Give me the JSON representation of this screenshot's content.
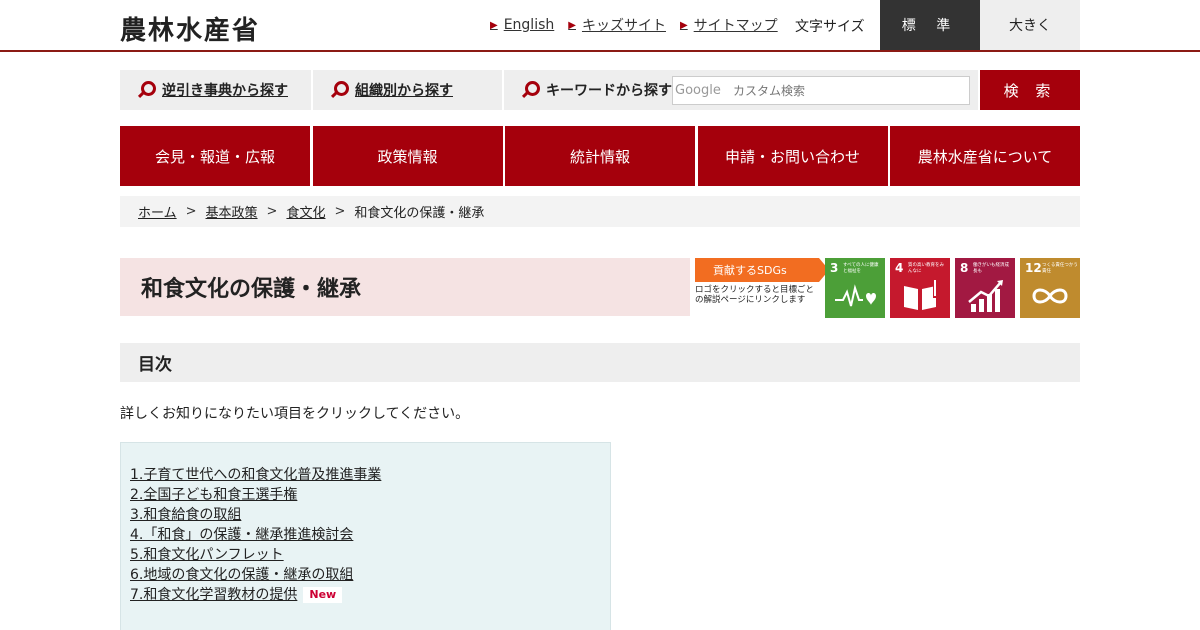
{
  "header": {
    "logo": "農林水産省",
    "links": [
      "English",
      "キッズサイト",
      "サイトマップ"
    ],
    "font_size_label": "文字サイズ",
    "font_size_standard": "標 準",
    "font_size_large": "大きく"
  },
  "search": {
    "reverse_lookup": "逆引き事典から探す",
    "by_org": "組織別から探す",
    "keyword_label": "キーワードから探す",
    "google_mark": "Google",
    "placeholder": "カスタム検索",
    "button": "検 索"
  },
  "nav": {
    "items": [
      "会見・報道・広報",
      "政策情報",
      "統計情報",
      "申請・お問い合わせ",
      "農林水産省について"
    ]
  },
  "breadcrumb": {
    "home": "ホーム",
    "basic_policy": "基本政策",
    "food_culture": "食文化",
    "current": "和食文化の保護・継承",
    "separator": ">"
  },
  "page": {
    "title": "和食文化の保護・継承"
  },
  "sdgs": {
    "badge": "貢献するSDGs",
    "note": "ロゴをクリックすると目標ごとの解説ページにリンクします",
    "tiles": [
      {
        "num": "3",
        "caption": "すべての人に健康と福祉を",
        "color": "#4c9f38",
        "icon": "heartbeat-icon"
      },
      {
        "num": "4",
        "caption": "質の高い教育をみんなに",
        "color": "#c5192d",
        "icon": "book-icon"
      },
      {
        "num": "8",
        "caption": "働きがいも経済成長も",
        "color": "#a21942",
        "icon": "growth-chart-icon"
      },
      {
        "num": "12",
        "caption": "つくる責任つかう責任",
        "color": "#bf8b2e",
        "icon": "infinity-icon"
      }
    ]
  },
  "toc": {
    "heading": "目次",
    "intro": "詳しくお知りになりたい項目をクリックしてください。",
    "items": [
      "1.子育て世代への和食文化普及推進事業",
      "2.全国子ども和食王選手権",
      "3.和食給食の取組",
      "4.「和食」の保護・継承推進検討会",
      "5.和食文化パンフレット",
      "6.地域の食文化の保護・継承の取組",
      "7.和食文化学習教材の提供"
    ],
    "new_badge": "New"
  }
}
